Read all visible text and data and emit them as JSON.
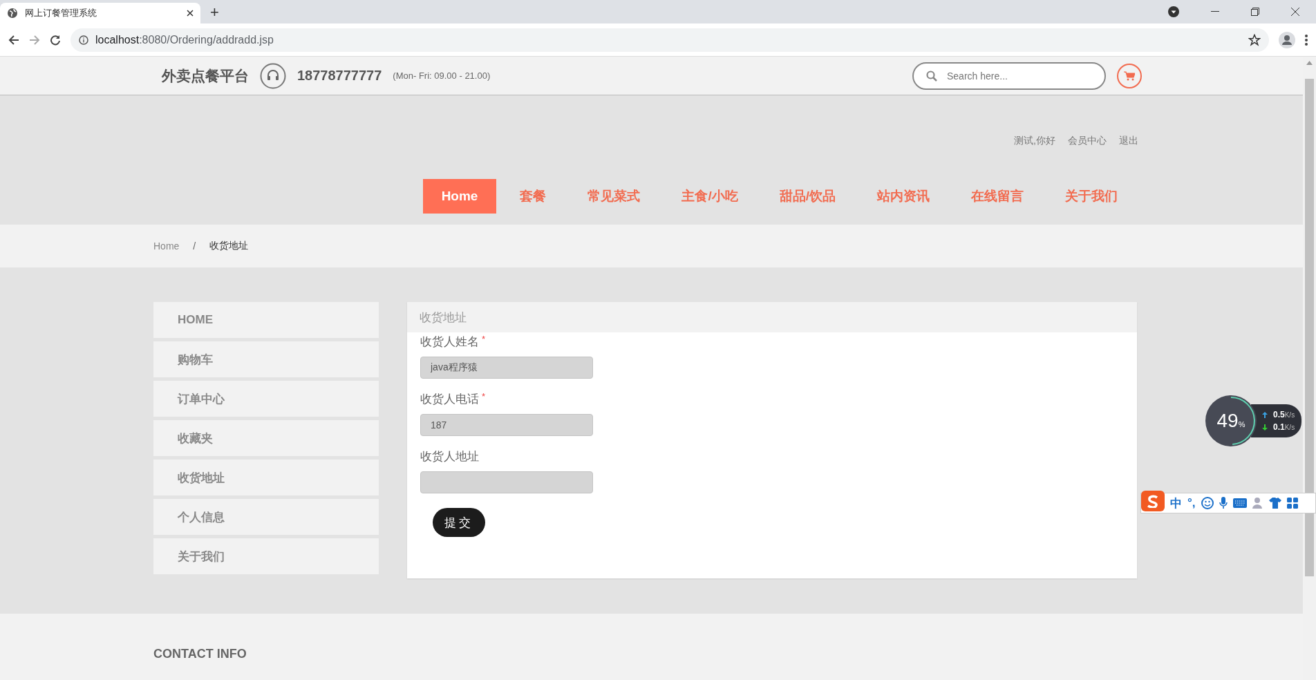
{
  "browser": {
    "tab_title": "网上订餐管理系统",
    "new_tab": "+",
    "url_host": "localhost",
    "url_path": ":8080/Ordering/addradd.jsp"
  },
  "header": {
    "brand": "外卖点餐平台",
    "phone": "18778777777",
    "hours": "(Mon- Fri: 09.00 - 21.00)",
    "search_placeholder": "Search here..."
  },
  "user_links": [
    "测试,你好",
    "会员中心",
    "退出"
  ],
  "nav": [
    {
      "label": "Home",
      "selected": true
    },
    {
      "label": "套餐",
      "selected": false
    },
    {
      "label": "常见菜式",
      "selected": false
    },
    {
      "label": "主食/小吃",
      "selected": false
    },
    {
      "label": "甜品/饮品",
      "selected": false
    },
    {
      "label": "站内资讯",
      "selected": false
    },
    {
      "label": "在线留言",
      "selected": false
    },
    {
      "label": "关于我们",
      "selected": false
    }
  ],
  "breadcrumb": {
    "items": [
      "Home",
      "收货地址"
    ],
    "separator": "/"
  },
  "sidebar": {
    "items": [
      "HOME",
      "购物车",
      "订单中心",
      "收藏夹",
      "收货地址",
      "个人信息",
      "关于我们"
    ]
  },
  "form": {
    "title": "收货地址",
    "required_mark": "*",
    "fields": [
      {
        "label": "收货人姓名",
        "required": true,
        "value": "java程序猿"
      },
      {
        "label": "收货人电话",
        "required": true,
        "value": "187"
      },
      {
        "label": "收货人地址",
        "required": false
      }
    ],
    "submit": "提交"
  },
  "footer": {
    "heading": "CONTACT INFO"
  },
  "net_meter": {
    "percent": "49",
    "unit": "%",
    "level": 0.49,
    "up": "0.5",
    "up_unit": "K/s",
    "down": "0.1",
    "down_unit": "K/s"
  },
  "ime_bar": {
    "mode": "中",
    "punct": "°,"
  }
}
